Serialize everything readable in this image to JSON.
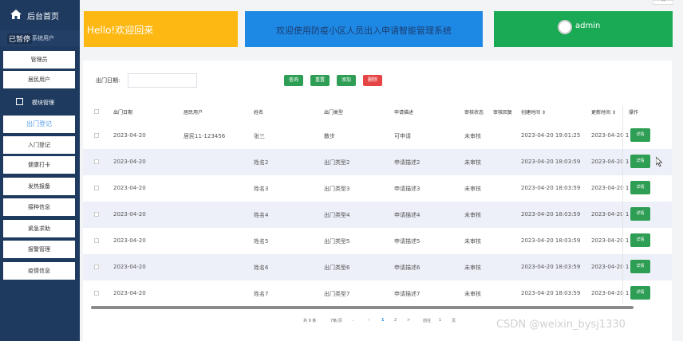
{
  "sidebar": {
    "home_label": "后台首页",
    "collapsed_badge": "已暂停",
    "system_user_label": "系统用户",
    "sub_items": [
      {
        "label": "管理员"
      },
      {
        "label": "居民用户"
      }
    ],
    "module_label": "模块管理",
    "menu_items": [
      {
        "label": "出门登记",
        "active": true
      },
      {
        "label": "入门登记"
      },
      {
        "label": "健康打卡"
      },
      {
        "label": "发热报备"
      },
      {
        "label": "接种信息"
      },
      {
        "label": "紧急求助"
      },
      {
        "label": "报警管理"
      },
      {
        "label": "疫情信息"
      }
    ]
  },
  "header": {
    "welcome": "Hello!欢迎回来",
    "system_title": "欢迎使用防疫小区人员出入申请智能管理系统",
    "user_name": "admin",
    "colors": {
      "yellow": "#fdb813",
      "blue": "#1e88e5",
      "green": "#1aaa55"
    }
  },
  "toolbar": {
    "date_label": "出门日期:",
    "date_placeholder": "",
    "query": "查询",
    "reset": "重置",
    "add": "添加",
    "delete": "删除"
  },
  "table": {
    "columns": [
      "出门日期",
      "居民用户",
      "姓名",
      "出门类型",
      "申请描述",
      "审核状态",
      "审核回复",
      "创建时间 ⇕",
      "更新时间 ⇕",
      "操作"
    ],
    "detail_label": "详情",
    "rows": [
      {
        "date": "2023-04-20",
        "user": "居民11-123456",
        "name": "张三",
        "type": "散步",
        "desc": "可申请",
        "status": "未审核",
        "reply": "",
        "created": "2023-04-20 19:01:25",
        "updated": "2023-04-20 1"
      },
      {
        "date": "2023-04-20",
        "user": "",
        "name": "姓名2",
        "type": "出门类型2",
        "desc": "申请描述2",
        "status": "未审核",
        "reply": "",
        "created": "2023-04-20 18:03:59",
        "updated": "2023-04-20 1"
      },
      {
        "date": "2023-04-20",
        "user": "",
        "name": "姓名3",
        "type": "出门类型3",
        "desc": "申请描述3",
        "status": "未审核",
        "reply": "",
        "created": "2023-04-20 18:03:59",
        "updated": "2023-04-20 1"
      },
      {
        "date": "2023-04-20",
        "user": "",
        "name": "姓名4",
        "type": "出门类型4",
        "desc": "申请描述4",
        "status": "未审核",
        "reply": "",
        "created": "2023-04-20 18:03:59",
        "updated": "2023-04-20 1"
      },
      {
        "date": "2023-04-20",
        "user": "",
        "name": "姓名5",
        "type": "出门类型5",
        "desc": "申请描述5",
        "status": "未审核",
        "reply": "",
        "created": "2023-04-20 18:03:59",
        "updated": "2023-04-20 1"
      },
      {
        "date": "2023-04-20",
        "user": "",
        "name": "姓名6",
        "type": "出门类型6",
        "desc": "申请描述6",
        "status": "未审核",
        "reply": "",
        "created": "2023-04-20 18:03:59",
        "updated": "2023-04-20 1"
      },
      {
        "date": "2023-04-20",
        "user": "",
        "name": "姓名7",
        "type": "出门类型7",
        "desc": "申请描述7",
        "status": "未审核",
        "reply": "",
        "created": "2023-04-20 18:03:59",
        "updated": "2023-04-20 1"
      }
    ]
  },
  "pagination": {
    "total": "共 9 条",
    "page_size": "7条/页",
    "prev": "<",
    "page1": "1",
    "page2": "2",
    "next": ">",
    "goto": "前往",
    "goto_value": "1",
    "page_suffix": "页"
  },
  "watermark": "CSDN @weixin_bysj1330"
}
